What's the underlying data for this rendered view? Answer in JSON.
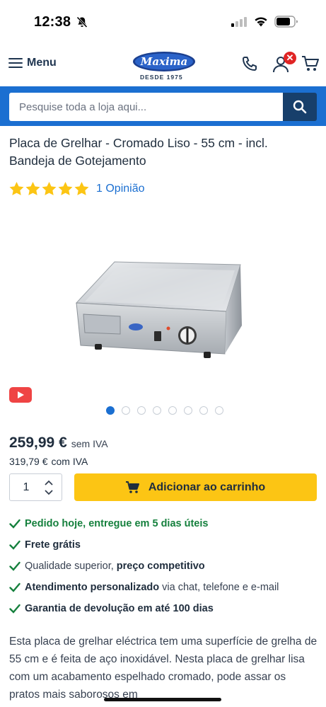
{
  "status_bar": {
    "time": "12:38"
  },
  "header": {
    "menu_label": "Menu",
    "logo_text": "Maxima",
    "logo_tagline": "DESDE 1975",
    "account_badge": "✕"
  },
  "search": {
    "placeholder": "Pesquise toda a loja aqui..."
  },
  "product": {
    "title": "Placa de Grelhar - Cromado Liso - 55 cm - incl. Bandeja de Gotejamento",
    "rating_stars": 5,
    "rating_link": "1 Opinião",
    "gallery": {
      "total": 8,
      "active_index": 0
    },
    "price": {
      "value": "259,99 €",
      "label": "sem IVA"
    },
    "price_vat": {
      "value": "319,79 €",
      "label": "com IVA"
    },
    "quantity": "1",
    "add_to_cart_label": "Adicionar ao carrinho"
  },
  "features": [
    {
      "green": "Pedido hoje, entregue em 5 dias úteis"
    },
    {
      "bold": "Frete grátis"
    },
    {
      "muted": "Qualidade superior,",
      "bold": "preço competitivo"
    },
    {
      "bold": "Atendimento personalizado",
      "muted": "via chat, telefone e e-mail"
    },
    {
      "bold": "Garantia de devolução em até 100 dias"
    }
  ],
  "description": "Esta placa de grelhar eléctrica tem uma superfície de grelha de 55 cm e é feita de aço inoxidável. Nesta placa de grelhar lisa com um acabamento espelhado cromado, pode assar os pratos mais saborosos em",
  "colors": {
    "brand_blue": "#1b6fd1",
    "search_button": "#173f6b",
    "cta_yellow": "#fcc514",
    "success_green": "#15803d",
    "star_yellow": "#fcc514",
    "badge_red": "#e02424"
  }
}
